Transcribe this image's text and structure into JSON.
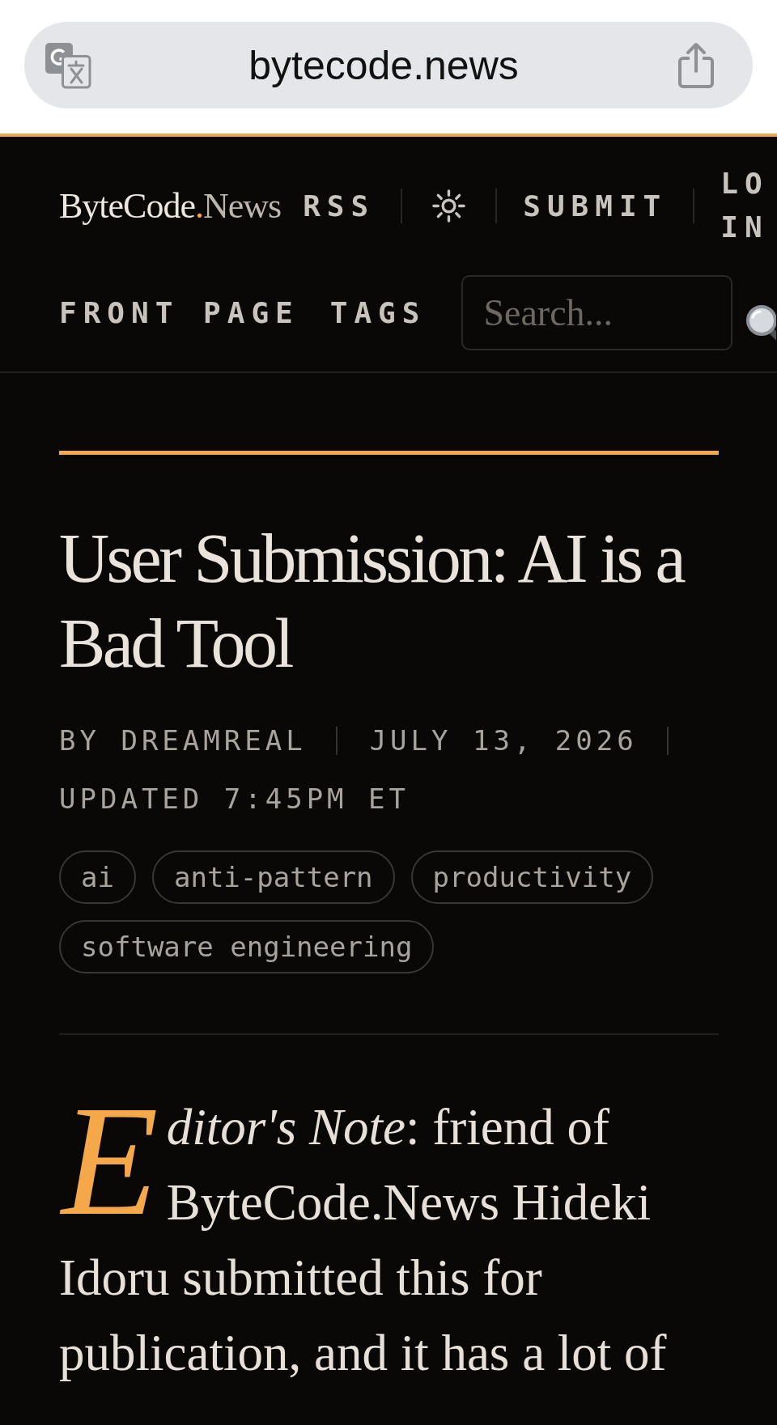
{
  "browser_bar": {
    "url": "bytecode.news"
  },
  "header": {
    "logo": {
      "name": "ByteCode",
      "dot": ".",
      "suffix": "News"
    },
    "top_links": [
      {
        "kind": "link",
        "label": "RSS"
      },
      {
        "kind": "theme_toggle"
      },
      {
        "kind": "link",
        "label": "SUBMIT"
      },
      {
        "kind": "wrapped_link",
        "lines": [
          "LO",
          "IN"
        ]
      }
    ],
    "main_nav": [
      {
        "label": "FRONT PAGE"
      },
      {
        "label": "TAGS"
      }
    ],
    "search": {
      "placeholder": "Search..."
    }
  },
  "article": {
    "title": "User Submission: AI is a Bad Tool",
    "byline": {
      "author": "BY DREAMREAL",
      "date": "JULY 13, 2026",
      "updated": "UPDATED 7:45PM ET"
    },
    "tags": [
      "ai",
      "anti-pattern",
      "productivity",
      "software engineering"
    ],
    "paragraphs": [
      "*Editor's Note*: friend of ByteCode.News Hideki Idoru submitted this for publication, and it has a lot of"
    ]
  }
}
